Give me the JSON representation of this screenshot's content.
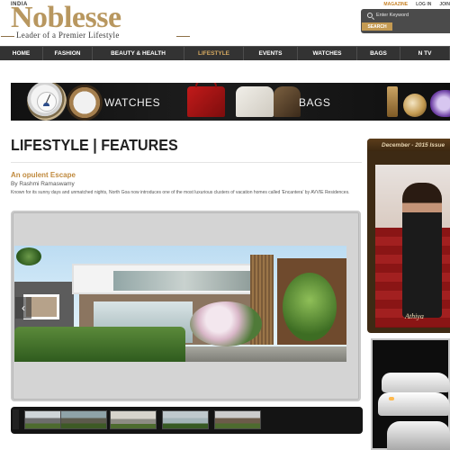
{
  "header": {
    "logo_country": "INDIA",
    "logo_text": "Noblesse",
    "tagline": "Leader of a Premier Lifestyle",
    "top_links": [
      "MAGAZINE",
      "LOG IN",
      "JOIN"
    ],
    "search_placeholder": "Enter Keyword",
    "search_button": "SEARCH"
  },
  "nav": {
    "items": [
      {
        "label": "HOME"
      },
      {
        "label": "FASHION"
      },
      {
        "label": "BEAUTY & HEALTH"
      },
      {
        "label": "LIFESTYLE",
        "active": true
      },
      {
        "label": "EVENTS"
      },
      {
        "label": "WATCHES"
      },
      {
        "label": "BAGS"
      },
      {
        "label": "N TV"
      }
    ]
  },
  "banner": {
    "watches_label": "WATCHES",
    "bags_label": "BAGS"
  },
  "page": {
    "title": "LIFESTYLE | FEATURES",
    "article_title": "An opulent Escape",
    "byline": "By Rashmi Ramaswamy",
    "description": "Known for its sunny days and unmatched nights, North Goa now introduces one of the most luxurious clusters of vacation homes called 'Encantera' by AVVIE Residences."
  },
  "sidebar": {
    "issue_label": "December - 2015 Issue",
    "cover_text": "Athiya"
  },
  "colors": {
    "brand_gold": "#b8975f",
    "nav_bg": "#333333",
    "nav_active": "#d5a860",
    "article_title": "#c08a3e"
  }
}
